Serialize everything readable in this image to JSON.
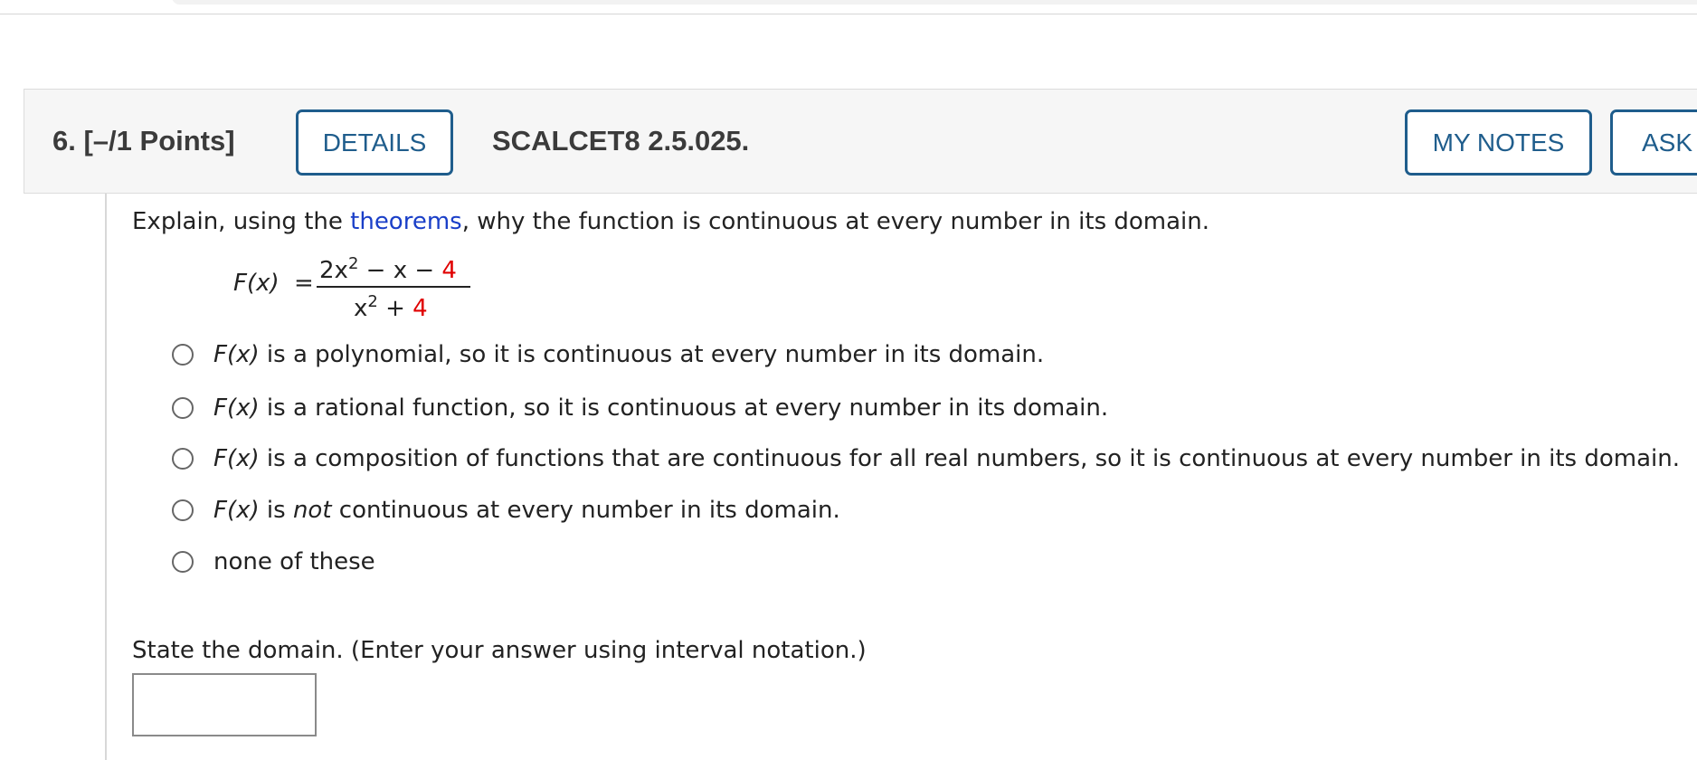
{
  "question": {
    "number_label": "6.",
    "points_label": "[–/1 Points]",
    "details_button": "DETAILS",
    "reference": "SCALCET8 2.5.025.",
    "my_notes_button": "MY NOTES",
    "ask_button": "ASK YOUR TEACHER"
  },
  "prompt": {
    "before_link": "Explain, using the ",
    "link_text": "theorems",
    "after_link": ", why the function is continuous at every number in its domain."
  },
  "formula": {
    "lhs": "F(x)",
    "equals": "=",
    "numerator_main": "2x",
    "numerator_exp": "2",
    "numerator_mid": " − x − ",
    "numerator_const": "4",
    "denominator_main": "x",
    "denominator_exp": "2",
    "denominator_mid": " + ",
    "denominator_const": "4",
    "highlight_color": "#e00000"
  },
  "options": [
    {
      "fx": "F(x)",
      "text": " is a polynomial, so it is continuous at every number in its domain."
    },
    {
      "fx": "F(x)",
      "text": " is a rational function, so it is continuous at every number in its domain."
    },
    {
      "fx": "F(x)",
      "text": " is a composition of functions that are continuous for all real numbers, so it is continuous at every number in its domain."
    },
    {
      "fx": "F(x)",
      "text_before": " is ",
      "emph": "not",
      "text_after": " continuous at every number in its domain."
    },
    {
      "text": "none of these"
    }
  ],
  "domain": {
    "prompt": "State the domain. (Enter your answer using interval notation.)",
    "value": ""
  },
  "colors": {
    "accent": "#1f5d8c",
    "link": "#1a3fc8",
    "header_bg": "#f6f6f6"
  }
}
